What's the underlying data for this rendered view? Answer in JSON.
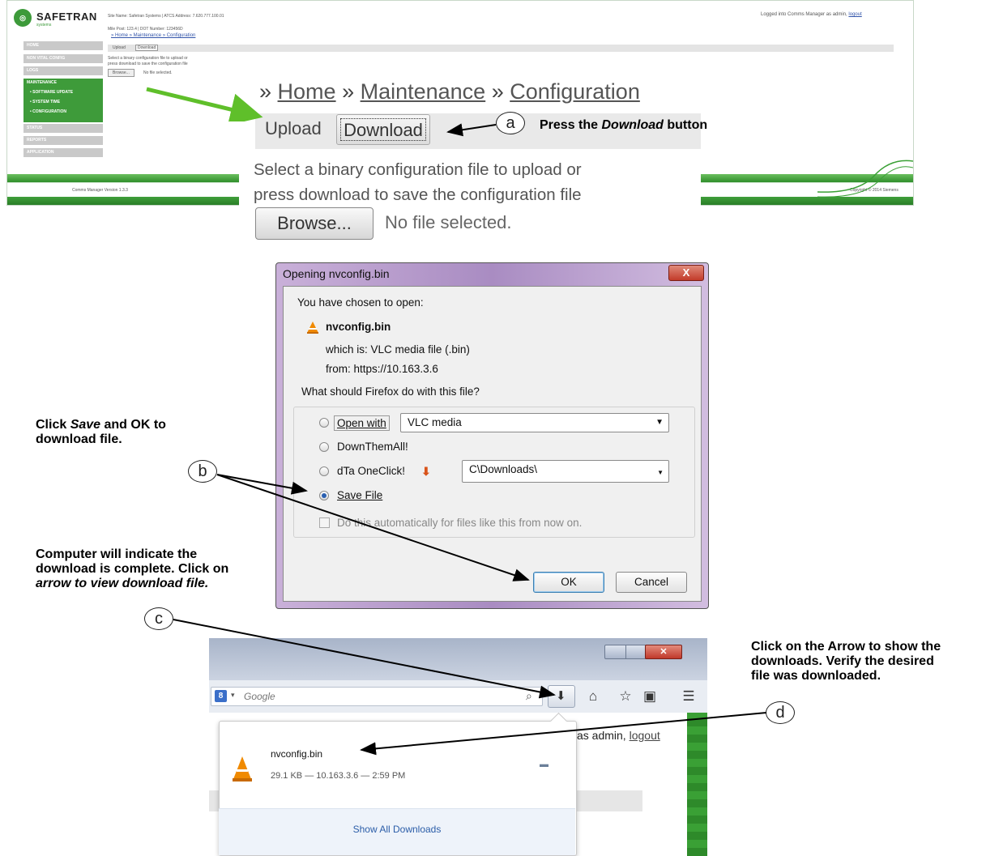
{
  "webapp": {
    "logo": "SAFETRAN",
    "logo_sub": "systems",
    "site_line": "Site Name: Safetran Systems  |  ATCS Address: 7.620.777.100.01",
    "mile_line": "Mile Post:  123.4          |  DOT Number:  123456D",
    "breadcrumb": "» Home » Maintenance » Configuration",
    "login_text": "Logged into Comms Manager as admin,",
    "logout": "logout",
    "sidebar": [
      "HOME",
      "NON VITAL CONFIG",
      "LOGS",
      "STATUS",
      "REPORTS",
      "APPLICATION"
    ],
    "maintenance": {
      "header": "MAINTENANCE",
      "items": [
        "SOFTWARE UPDATE",
        "SYSTEM TIME",
        "CONFIGURATION"
      ]
    },
    "tabs": [
      "Upload",
      "Download"
    ],
    "help1": "Select a binary configuration file to upload or",
    "help2": "press download to save the configuration file",
    "browse": "Browse...",
    "no_file": "No file selected.",
    "version": "Comms Manager Version 1.3.3",
    "copyright": "Copyright © 2014 Siemens"
  },
  "zoom": {
    "crumb_prefix": "» ",
    "home": "Home",
    "sep": " » ",
    "maintenance": "Maintenance",
    "configuration": "Configuration",
    "upload": "Upload",
    "download": "Download",
    "help1": "Select a binary configuration file to upload or",
    "help2": "press download to save the configuration file",
    "browse": "Browse...",
    "no_file": "No file selected."
  },
  "callouts": {
    "a": "a",
    "a_text_pre": "Press the ",
    "a_text_em": "Download",
    "a_text_post": " button",
    "b": "b",
    "b_text_pre": "Click ",
    "b_text_em": "Save",
    "b_text_post": " and OK to",
    "b_text_line2": "download file.",
    "c": "c",
    "c_line1": "Computer will indicate the",
    "c_line2": "download is complete. Click on",
    "c_line3": "arrow to view download file.",
    "d": "d",
    "d_line1": "Click on the Arrow to show the",
    "d_line2": "downloads. Verify the desired",
    "d_line3": "file was downloaded."
  },
  "dialog": {
    "title": "Opening nvconfig.bin",
    "close": "X",
    "intro": "You have chosen to open:",
    "filename": "nvconfig.bin",
    "which_label": "which is:",
    "which_value": "VLC media file (.bin)",
    "from_label": "from:",
    "from_value": "https://10.163.3.6",
    "question": "What should Firefox do with this file?",
    "open_with": "Open with",
    "open_with_value": "VLC media",
    "downthemall": "DownThemAll!",
    "dta": "dTa OneClick!",
    "dta_path": "C\\Downloads\\",
    "save_file": "Save File",
    "auto": "Do this automatically for files like this from now on.",
    "ok": "OK",
    "cancel": "Cancel"
  },
  "browser": {
    "search_placeholder": "Google",
    "logged_as": "as admin,",
    "logout": "logout",
    "download_name": "nvconfig.bin",
    "download_meta": "29.1 KB — 10.163.3.6 — 2:59 PM",
    "show_all": "Show All Downloads"
  },
  "colors": {
    "brand_green": "#3d9a3a",
    "arrow_green": "#5fbf2a",
    "dialog_frame": "#a98cc2"
  }
}
